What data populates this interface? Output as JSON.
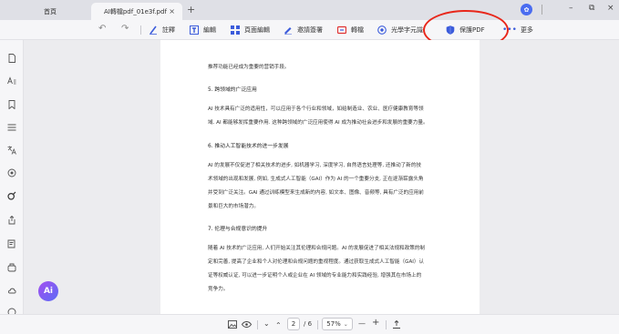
{
  "tabs": {
    "home": "首頁",
    "active": "AI轉檔pdf_01e3f.pdf",
    "close": "×",
    "add": "+"
  },
  "window": {
    "minimize": "–",
    "maximize": "⧉",
    "close": "×",
    "logo": "✿"
  },
  "toolbar": {
    "undo": "↶",
    "redo": "↷",
    "annotate": "註釋",
    "edit": "編輯",
    "page_edit": "頁面編輯",
    "request_sign": "邀請簽署",
    "convert": "轉檔",
    "ocr": "光學字元識",
    "protect": "保護PDF",
    "more": "更多",
    "accent_color": "#3b5bdb",
    "annotation_circle_color": "#e8271b"
  },
  "document": {
    "lines": [
      "推荐功能已经成为重要的营销手段。",
      "5. 跨领域的广泛应用",
      "AI 技术具有广泛的适用性，可以应用于各个行业和领域，如给制造业、农业、医疗健康教育等领",
      "域. AI 都能够发挥重要作用. 这种跨领域的广泛应用使得 AI 成为推动社会进步和发展的重要力量。",
      "6. 推动人工智能技术的进一步发展",
      "AI 的发展不仅促进了相关技术的进步, 如机器学习, 深度学习, 自然语言处理等, 还推动了新的技",
      "术领域的出现和发展, 例如, 生成式人工智能（GAI）作为 AI 的一个重要分支, 正在逐渐崭露头角",
      "并受到广泛关注。GAI 通过训练模型来生成新的内容, 如文本、图像、音频等, 具有广泛的应用前",
      "景和巨大的市场潜力。",
      "7. 伦理与合规意识的提升",
      "随着 AI 技术的广泛应用, 人们开始关注其伦理和合规问题。AI 的发展促进了相关法规和政策的制",
      "定和完善, 提高了企业和个人对伦理和合规问题的重视程度。通过获取生成式人工智能（GAI）认",
      "证等权威认证, 可以进一步证明个人或企业在 AI 领域的专业能力和实践经验, 增强其在市场上的",
      "竞争力。"
    ]
  },
  "bottom": {
    "current_page": "2",
    "total_pages": "/ 6",
    "zoom": "57%",
    "zoom_out": "—",
    "zoom_in": "+",
    "up": "⌃",
    "down": "⌄"
  },
  "ai_button": "Ai"
}
